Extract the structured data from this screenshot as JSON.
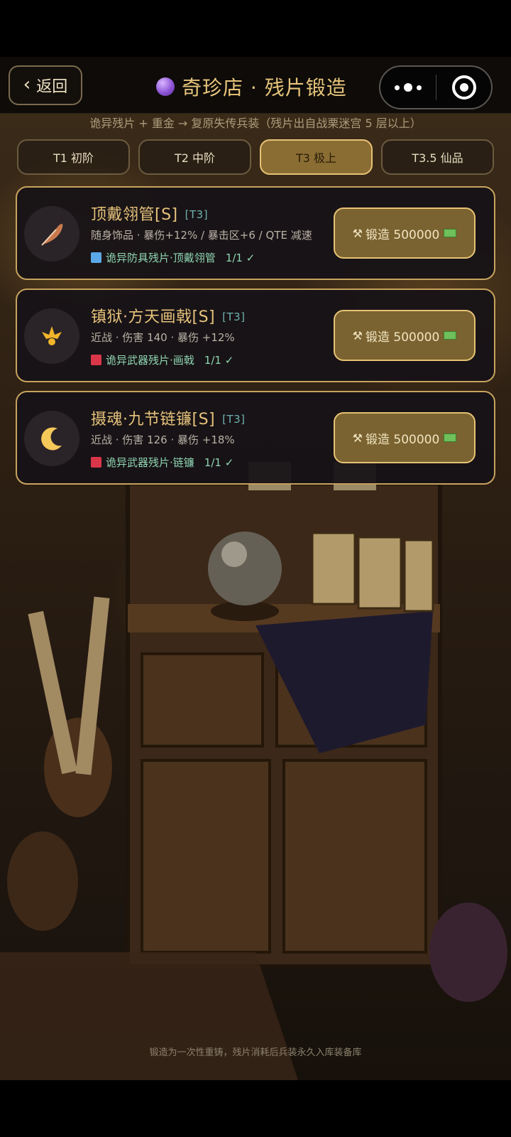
{
  "header": {
    "back_label": "返回",
    "title": "奇珍店 · 残片锻造",
    "title_icon": "crystal-ball-icon"
  },
  "subtitle": "诡异残片 + 重金 → 复原失传兵装（残片出自战栗迷宫 5 层以上）",
  "tabs": [
    {
      "label": "T1 初阶",
      "active": false
    },
    {
      "label": "T2 中阶",
      "active": false
    },
    {
      "label": "T3 极上",
      "active": true
    },
    {
      "label": "T3.5 仙品",
      "active": false
    }
  ],
  "items": [
    {
      "icon": "feather-icon",
      "name": "顶戴翎管[S]",
      "tier": "[T3]",
      "stats": "随身饰品 · 暴伤+12% / 暴击区+6 / QTE 减速",
      "fragment": "诡异防具残片·顶戴翎管",
      "fragment_color": "#5ba8e6",
      "count": "1/1 ✓",
      "forge_label": "锻造 500000"
    },
    {
      "icon": "trident-icon",
      "name": "镇狱·方天画戟[S]",
      "tier": "[T3]",
      "stats": "近战 · 伤害 140 · 暴伤 +12%",
      "fragment": "诡异武器残片·画戟",
      "fragment_color": "#d9364a",
      "count": "1/1 ✓",
      "forge_label": "锻造 500000"
    },
    {
      "icon": "crescent-moon-icon",
      "name": "摄魂·九节链镰[S]",
      "tier": "[T3]",
      "stats": "近战 · 伤害 126 · 暴伤 +18%",
      "fragment": "诡异武器残片·链镰",
      "fragment_color": "#d9364a",
      "count": "1/1 ✓",
      "forge_label": "锻造 500000"
    }
  ],
  "footer_note": "锻造为一次性重铸，残片消耗后兵装永久入库装备库",
  "colors": {
    "accent_gold": "#e6c27b",
    "active_tab": "#8a6d33",
    "card_border": "#c7a35e"
  }
}
